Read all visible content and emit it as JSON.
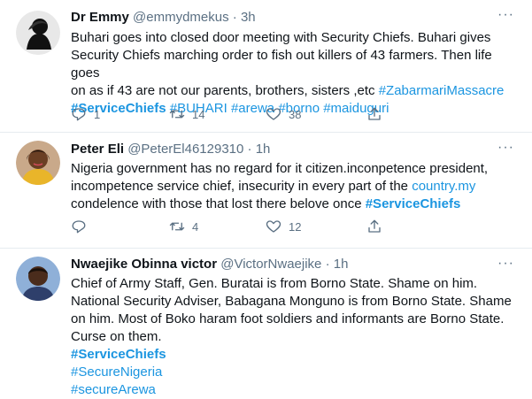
{
  "tweets": [
    {
      "name": "Dr Emmy",
      "handle": "@emmydmekus",
      "dot": "·",
      "time": "3h",
      "text_lines": [
        "Buhari goes into closed door meeting with Security Chiefs. Buhari gives",
        "Security Chiefs marching order to fish out killers of 43 farmers. Then life goes",
        "on as if  43 are not our parents, brothers, sisters ,etc "
      ],
      "hashtag_inline": "#ZabarmariMassacre",
      "hashtags_line": [
        "#ServiceChiefs",
        "#BUHARI",
        "#arewa",
        "#borno",
        "#maiduguri"
      ],
      "replies": "1",
      "retweets": "14",
      "likes": "38"
    },
    {
      "name": "Peter Eli",
      "handle": "@PeterEl46129310",
      "dot": "·",
      "time": "1h",
      "text_lines": [
        "Nigeria government has no regard for it citizen.inconpetence president,",
        "incompetence service chief, insecurity in every part of the "
      ],
      "link_text": "country.my",
      "line3": "condelence with those that lost there belove once ",
      "hashtag_end": "#ServiceChiefs",
      "replies": "",
      "retweets": "4",
      "likes": "12"
    },
    {
      "name": "Nwaejike Obinna victor",
      "handle": "@VictorNwaejike",
      "dot": "·",
      "time": "1h",
      "text_lines": [
        "Chief of Army Staff, Gen. Buratai is from Borno State. Shame on him.",
        "National Security Adviser, Babagana Monguno is from Borno State. Shame",
        "on him. Most of Boko haram foot soldiers and informants are Borno State.",
        "Curse on them."
      ],
      "hashtags": [
        "#ServiceChiefs",
        "#SecureNigeria",
        "#secureArewa"
      ]
    }
  ],
  "more_label": "···",
  "colors": {
    "link": "#1b95e0",
    "muted": "#5b7083",
    "text": "#0f1419"
  }
}
